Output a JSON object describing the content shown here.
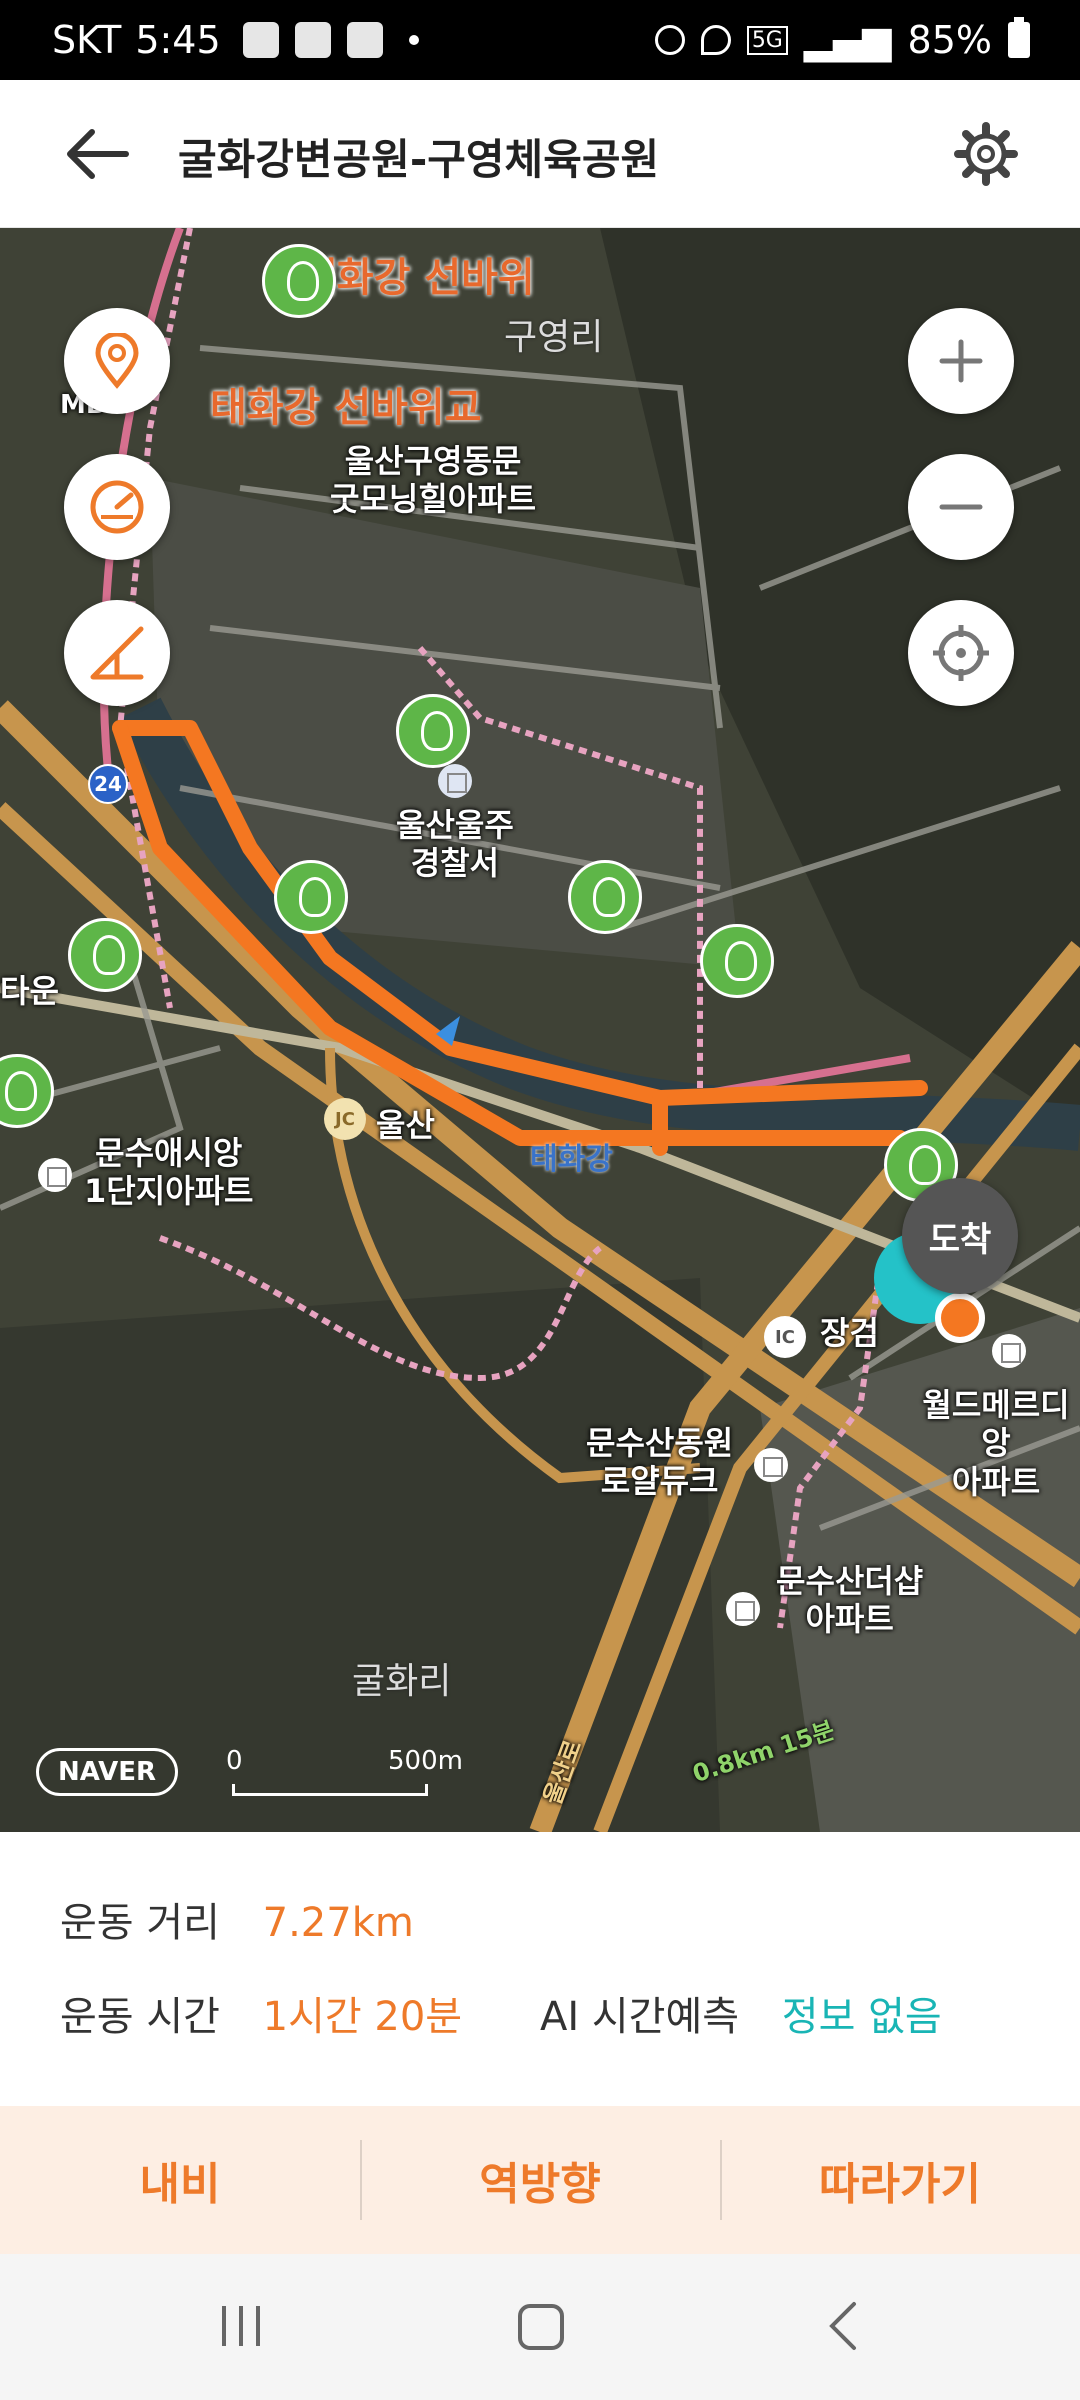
{
  "status": {
    "carrier": "SKT",
    "time": "5:45",
    "network": "5G",
    "battery": "85%"
  },
  "header": {
    "title": "굴화강변공원-구영체육공원"
  },
  "map": {
    "labels": {
      "taehwa_rock": "태화강 선바위",
      "taehwa_bridge": "태화강 선바위교",
      "guyeongri": "구영리",
      "apt1": "울산구영동문\n굿모닝힐아파트",
      "police": "울산울주\n경찰서",
      "apt2": "문수애시앙\n1단지아파트",
      "ulsan": "울산",
      "taehwagang": "태화강",
      "janggeom": "장검",
      "apt3": "문수산동원\n로얄듀크",
      "apt4": "문수산더샵\n아파트",
      "apt5": "월드메르디앙\n아파트",
      "gulhwari": "굴화리",
      "town": "타운",
      "mb": "MB",
      "trail": "0.8km 15분",
      "road": "울산로"
    },
    "jc_label": "JC",
    "ic_label": "IC",
    "highway_number": "24",
    "arrive": "도착",
    "naver": "NAVER",
    "scale_zero": "0",
    "scale_label": "500m"
  },
  "info": {
    "distance_label": "운동 거리",
    "distance_value": "7.27km",
    "time_label": "운동 시간",
    "time_value": "1시간 20분",
    "ai_label": "AI 시간예측",
    "ai_value": "정보 없음"
  },
  "actions": {
    "navi": "내비",
    "reverse": "역방향",
    "follow": "따라가기"
  },
  "colors": {
    "accent": "#ee7a2a",
    "teal": "#19b5b5",
    "route": "#f47721",
    "panel_bg": "#fdeee3"
  }
}
